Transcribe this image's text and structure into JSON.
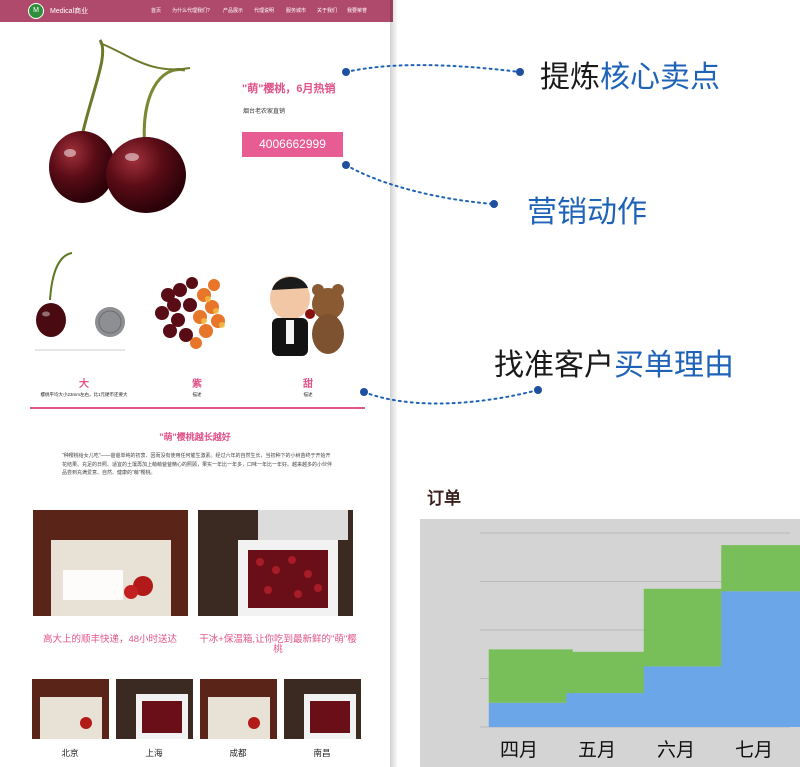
{
  "site": {
    "brand": "Medical商业",
    "logo_letter": "M",
    "nav": [
      "首页",
      "为什么代理我们?",
      "产品展示",
      "代理说明",
      "服务城市",
      "关于我们",
      "我要荣誉"
    ],
    "hero": {
      "headline": "\"萌\"樱桃，6月热销",
      "subline": "烟台老农家直销",
      "phone": "4006662999"
    },
    "features": [
      {
        "title": "大",
        "desc": "樱桃平均大小23mm左右，比1元硬币还要大"
      },
      {
        "title": "紫",
        "desc": "描述"
      },
      {
        "title": "甜",
        "desc": "描述"
      }
    ],
    "section": {
      "title": "\"萌\"樱桃越长越好",
      "paragraph": "\"种樱桃给女儿吃\"——爸爸单纯的初衷、因而没有使用任何催生激素。经过六年的自然生长，当初种下的小树苗终于开始开花结果。充足的日照、适宜的土壤再加上萌萌爸爸精心的照顾，果实一年比一年多，口味一年比一年好。越来越多的小伙伴品尝到充满爱意、自然、健康的\"萌\"樱桃。"
    },
    "captions": [
      "高大上的顺丰快递，48小时送达",
      "干冰+保温箱,让你吃到最新鲜的\"萌\"樱桃"
    ],
    "cities": [
      "北京",
      "上海",
      "成都",
      "南昌"
    ]
  },
  "annotations": {
    "a1": {
      "black": "提炼",
      "blue": "核心卖点"
    },
    "a2": {
      "black": "",
      "blue": "营销动作"
    },
    "a3": {
      "black": "找准客户",
      "blue": "买单理由"
    }
  },
  "chart_data": {
    "type": "bar",
    "stacked": true,
    "title": "订单",
    "categories": [
      "四月",
      "五月",
      "六月",
      "七月"
    ],
    "series": [
      {
        "color": "#6aa6e8",
        "values": [
          5,
          7,
          12.5,
          28
        ]
      },
      {
        "color": "#78bf59",
        "values": [
          11,
          8.5,
          16,
          9.5
        ]
      }
    ],
    "ylim": [
      0,
      40
    ],
    "grid": true,
    "colors": {
      "brand_pink": "#e2558a",
      "nav": "#b04a6c",
      "annotation_blue": "#1f63b8"
    }
  }
}
